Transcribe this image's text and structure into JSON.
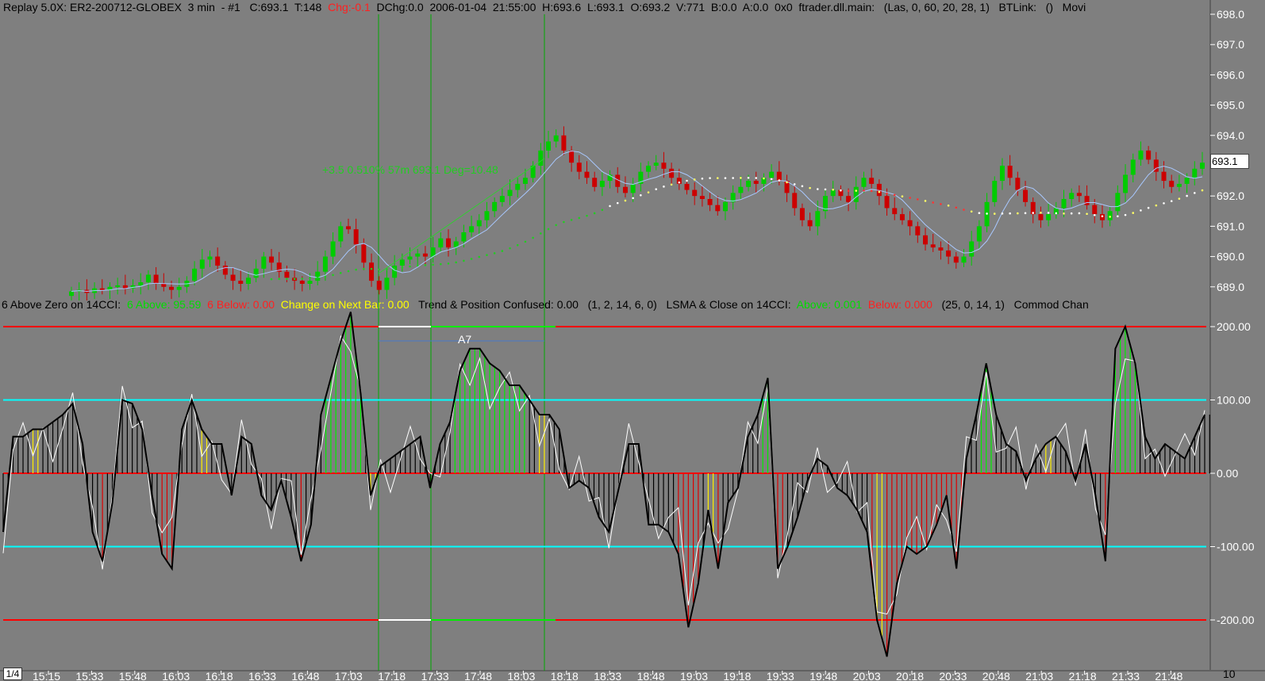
{
  "header": {
    "parts": [
      {
        "text": "Replay 5.0X: ER2-200712-GLOBEX  3 min  - #1   C:693.1  T:148  ",
        "color": "#000000"
      },
      {
        "text": "Chg:-0.1",
        "color": "#ff2020"
      },
      {
        "text": "  DChg:0.0  2006-01-04  21:55:00  H:693.6  L:693.1  O:693.2  V:771  B:0.0  A:0.0  0x0  ftrader.dll.main:   (Las, 0, 60, 20, 28, 1)   BTLink:   ()   Movi",
        "color": "#000000"
      }
    ]
  },
  "indicator_header": {
    "parts": [
      {
        "text": "6 Above Zero on 14CCI:  ",
        "color": "#000000"
      },
      {
        "text": "6 Above: 95.59",
        "color": "#00dd00"
      },
      {
        "text": "  6 Below: 0.00",
        "color": "#ff2020"
      },
      {
        "text": "  Change on Next Bar: 0.00",
        "color": "#ffff00"
      },
      {
        "text": "   Trend & Position Confused: 0.00   (1, 2, 14, 6, 0)   LSMA & Close on 14CCI:  ",
        "color": "#000000"
      },
      {
        "text": "Above: 0.001",
        "color": "#00dd00"
      },
      {
        "text": "  Below: 0.000",
        "color": "#ff2020"
      },
      {
        "text": "   (25, 0, 14, 1)   Commod Chan",
        "color": "#000000"
      }
    ]
  },
  "price_annotation": "+3.5  0.510%  57m  693.1  Deg=10.48",
  "marker_label": "A7",
  "last_price": "693.1",
  "page_indicator": "1/4",
  "corner_label": "10",
  "price_axis_labels": [
    "698.0",
    "697.0",
    "696.0",
    "695.0",
    "694.0",
    "692.0",
    "691.0",
    "690.0",
    "689.0"
  ],
  "cci_axis_labels": [
    "200.00",
    "100.00",
    "0.00",
    "-100.00",
    "-200.00"
  ],
  "time_labels": [
    "15:15",
    "15:33",
    "15:48",
    "16:03",
    "16:18",
    "16:33",
    "16:48",
    "17:03",
    "17:18",
    "17:33",
    "17:48",
    "18:03",
    "18:18",
    "18:33",
    "18:48",
    "19:03",
    "19:18",
    "19:33",
    "19:48",
    "20:03",
    "20:18",
    "20:33",
    "20:48",
    "21:03",
    "21:18",
    "21:33",
    "21:48"
  ],
  "colors": {
    "background": "#7f7f7f",
    "up_candle": "#00cc00",
    "down_candle": "#cc0000",
    "ma_line": "#a8c8ff",
    "cci_line": "#000000",
    "turbo_line": "#ffffff",
    "cyan_level": "#00ffff",
    "red_level": "#ff0000",
    "vline": "#00aa00"
  },
  "chart_data": [
    {
      "type": "candlestick",
      "title": "ER2-200712-GLOBEX 3 min",
      "ylim": [
        688.6,
        698.3
      ],
      "close_series": [
        688.85,
        688.9,
        688.8,
        688.95,
        688.9,
        689.0,
        689.05,
        688.95,
        689.05,
        689.15,
        689.4,
        689.1,
        689.0,
        688.9,
        689.0,
        689.2,
        689.6,
        689.9,
        690.0,
        689.7,
        689.4,
        689.2,
        689.1,
        689.3,
        689.6,
        690.0,
        689.8,
        689.5,
        689.3,
        689.2,
        689.1,
        689.2,
        689.5,
        690.0,
        690.5,
        691.0,
        690.9,
        690.4,
        689.8,
        689.2,
        688.9,
        689.3,
        689.7,
        689.9,
        690.0,
        690.1,
        690.0,
        690.3,
        690.6,
        690.3,
        690.5,
        690.8,
        691.0,
        691.2,
        691.5,
        691.8,
        692.0,
        692.2,
        692.4,
        692.6,
        693.0,
        693.5,
        693.8,
        694.0,
        693.5,
        693.1,
        692.8,
        692.6,
        692.3,
        692.5,
        692.7,
        692.3,
        692.1,
        692.4,
        692.8,
        693.0,
        693.1,
        692.9,
        692.6,
        692.4,
        692.2,
        692.0,
        691.9,
        691.7,
        691.5,
        691.8,
        692.1,
        692.3,
        692.5,
        692.4,
        692.6,
        692.8,
        692.5,
        692.1,
        691.6,
        691.2,
        691.0,
        691.5,
        692.0,
        692.2,
        692.0,
        691.8,
        692.3,
        692.6,
        692.4,
        692.0,
        691.6,
        691.4,
        691.2,
        691.0,
        690.7,
        690.4,
        690.3,
        690.2,
        690.0,
        689.8,
        690.0,
        690.5,
        691.0,
        691.8,
        692.5,
        693.0,
        692.6,
        692.2,
        691.8,
        691.4,
        691.2,
        691.4,
        691.6,
        691.9,
        692.1,
        692.0,
        691.7,
        691.4,
        691.2,
        691.5,
        692.1,
        692.7,
        693.2,
        693.5,
        693.2,
        692.8,
        692.5,
        692.3,
        692.4,
        692.6,
        692.9,
        693.1
      ]
    },
    {
      "type": "line",
      "title": "14CCI",
      "ylim": [
        -260,
        215
      ],
      "levels": [
        200,
        100,
        0,
        -100,
        -200
      ],
      "cci_series": [
        -80,
        50,
        50,
        60,
        60,
        70,
        80,
        95,
        40,
        -80,
        -120,
        -40,
        100,
        95,
        60,
        -30,
        -110,
        -130,
        60,
        100,
        60,
        40,
        40,
        -30,
        50,
        40,
        -30,
        -50,
        -10,
        -60,
        -120,
        -70,
        80,
        130,
        180,
        220,
        110,
        -30,
        10,
        20,
        30,
        40,
        50,
        -20,
        40,
        70,
        140,
        170,
        170,
        150,
        140,
        120,
        120,
        100,
        80,
        80,
        60,
        -20,
        -10,
        -20,
        -60,
        -80,
        -20,
        40,
        40,
        -70,
        -70,
        -80,
        -110,
        -210,
        -150,
        -50,
        -130,
        -40,
        -20,
        50,
        80,
        130,
        -130,
        -100,
        -60,
        -10,
        20,
        10,
        -20,
        -30,
        -50,
        -80,
        -200,
        -250,
        -150,
        -100,
        -110,
        -100,
        -70,
        -30,
        -130,
        20,
        80,
        150,
        80,
        40,
        30,
        -10,
        20,
        40,
        50,
        30,
        -10,
        40,
        -30,
        -120,
        170,
        200,
        150,
        50,
        20,
        40,
        30,
        20,
        50,
        80
      ]
    }
  ]
}
